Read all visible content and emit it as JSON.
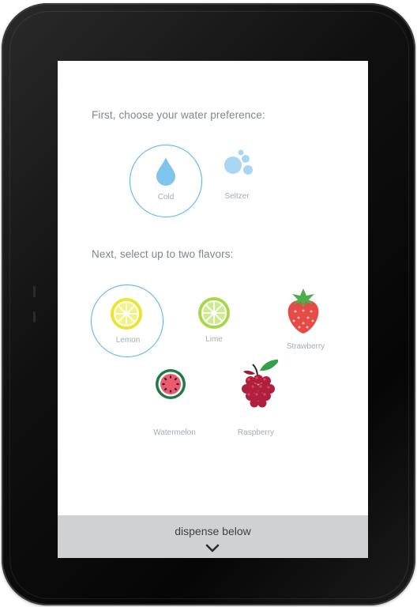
{
  "water": {
    "heading": "First, choose your water preference:",
    "options": [
      {
        "label": "Cold",
        "icon": "water-drop-icon",
        "selected": true
      },
      {
        "label": "Seltzer",
        "icon": "bubbles-icon",
        "selected": false
      }
    ]
  },
  "flavors": {
    "heading": "Next, select up to two flavors:",
    "options": [
      {
        "label": "Lemon",
        "icon": "lemon-icon",
        "selected": true
      },
      {
        "label": "Lime",
        "icon": "lime-icon",
        "selected": false
      },
      {
        "label": "Strawberry",
        "icon": "strawberry-icon",
        "selected": false
      },
      {
        "label": "Watermelon",
        "icon": "watermelon-icon",
        "selected": false
      },
      {
        "label": "Raspberry",
        "icon": "raspberry-icon",
        "selected": false
      }
    ]
  },
  "footer": {
    "label": "dispense below",
    "icon": "chevron-down-icon"
  },
  "colors": {
    "accent": "#5ab0e6",
    "drop": "#7fc4ec",
    "bubbles": "#a9d6f2",
    "lemon": "#e8e633",
    "lime": "#a7d84a",
    "strawberry": "#e64b46",
    "watermelon_rind": "#1f7a45",
    "watermelon_flesh": "#ef5b6e",
    "raspberry": "#b0203e",
    "footer_bg": "#cfd1d3"
  }
}
